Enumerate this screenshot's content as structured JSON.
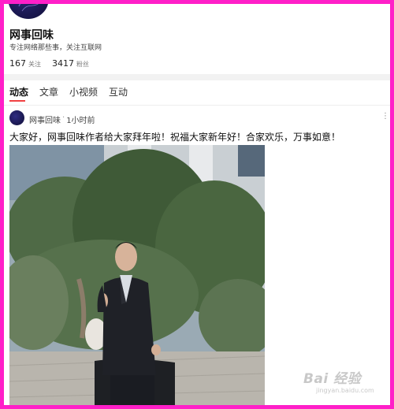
{
  "profile": {
    "name": "网事回味",
    "bio": "专注网络那些事，关注互联网",
    "following_count": "167",
    "following_label": "关注",
    "followers_count": "3417",
    "followers_label": "粉丝"
  },
  "tabs": [
    {
      "label": "动态",
      "active": true
    },
    {
      "label": "文章",
      "active": false
    },
    {
      "label": "小视频",
      "active": false
    },
    {
      "label": "互动",
      "active": false
    }
  ],
  "post": {
    "author": "网事回味",
    "separator": "·",
    "time": "1小时前",
    "text": "大家好，网事回味作者给大家拜年啦！祝福大家新年好！合家欢乐，万事如意！"
  },
  "watermark": {
    "main": "Bai 经验",
    "sub": "jingyan.baidu.com"
  },
  "colors": {
    "frame": "#ff1fc8",
    "tab_underline": "#f04142"
  }
}
